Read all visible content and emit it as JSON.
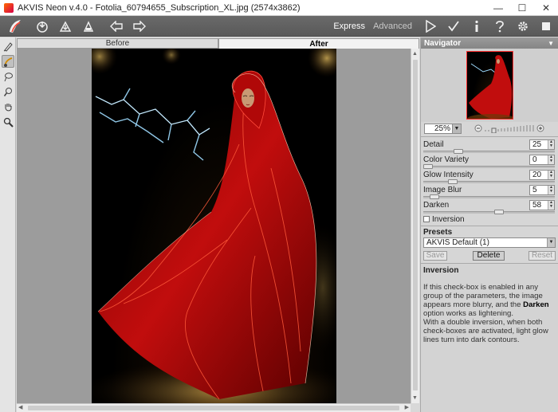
{
  "window": {
    "title": "AKVIS Neon v.4.0 - Fotolia_60794655_Subscription_XL.jpg (2574x3862)",
    "minimize_icon": "minimize-icon",
    "maximize_icon": "maximize-icon",
    "close_icon": "close-icon"
  },
  "toolbar": {
    "buttons": [
      "logo-icon",
      "open-icon",
      "save-icon",
      "print-icon",
      "back-icon",
      "forward-icon"
    ],
    "mode_express": "Express",
    "mode_advanced": "Advanced",
    "right_buttons": [
      "run-icon",
      "apply-icon",
      "info-icon",
      "help-icon",
      "settings-icon",
      "stop-icon"
    ]
  },
  "tools": [
    "drawing-tool-icon",
    "effect-brush-icon",
    "lasso-icon",
    "eraser-icon",
    "hand-icon",
    "zoom-icon"
  ],
  "tabs": {
    "before": "Before",
    "after": "After",
    "active": "After"
  },
  "navigator": {
    "title": "Navigator",
    "zoom": "25%"
  },
  "params": [
    {
      "label": "Detail",
      "value": "25",
      "level": 0.25
    },
    {
      "label": "Color Variety",
      "value": "0",
      "level": 0.0
    },
    {
      "label": "Glow Intensity",
      "value": "20",
      "level": 0.2
    },
    {
      "label": "Image Blur",
      "value": "5",
      "level": 0.05
    },
    {
      "label": "Darken",
      "value": "58",
      "level": 0.58
    }
  ],
  "inversion": {
    "label": "Inversion",
    "checked": false
  },
  "presets": {
    "title": "Presets",
    "selected": "AKVIS Default (1)",
    "save": "Save",
    "delete": "Delete",
    "reset": "Reset"
  },
  "help": {
    "title": "Inversion",
    "text_1": "If this check-box is enabled in any group of the parameters, the image appears more blurry, and the ",
    "text_bold": "Darken",
    "text_2": " option works as lightening.",
    "text_3": "With a double inversion, when both check-boxes are activated, light glow lines turn into dark contours."
  },
  "colors": {
    "accent_red": "#d01010",
    "glow_blue": "#9fdcff",
    "toolbar_bg": "#5f5f5f"
  }
}
